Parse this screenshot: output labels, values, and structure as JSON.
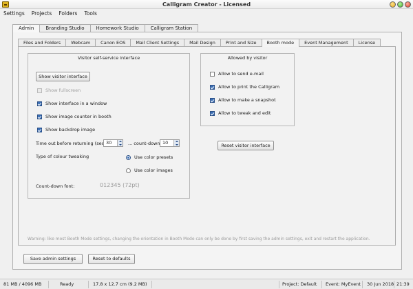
{
  "window": {
    "title": "Calligram Creator - Licensed"
  },
  "menu": [
    "Settings",
    "Projects",
    "Folders",
    "Tools"
  ],
  "top_tabs": [
    "Admin",
    "Branding Studio",
    "Homework Studio",
    "Calligram Station"
  ],
  "sub_tabs": [
    "Files and Folders",
    "Webcam",
    "Canon EOS",
    "Mail Client Settings",
    "Mail Design",
    "Print and Size",
    "Booth mode",
    "Event Management",
    "License"
  ],
  "visitor_interface": {
    "title": "Visitor self-service interface",
    "show_button": "Show visitor interface",
    "show_fullscreen": "Show fullscreen",
    "show_in_window": "Show interface in a window",
    "show_image_counter": "Show image counter in booth",
    "show_backdrop": "Show backdrop image",
    "timeout_label": "Time out before returning (sec)",
    "timeout_value": "30",
    "countdown_label": "... count-down",
    "countdown_value": "10",
    "colour_tweaking_label": "Type of colour tweaking",
    "use_presets": "Use color presets",
    "use_images": "Use color images",
    "font_label": "Count-down font:",
    "font_sample": "012345 (72pt)"
  },
  "allowed": {
    "title": "Allowed by visitor",
    "send_email": "Allow to send e-mail",
    "print": "Allow to print the Calligram",
    "snapshot": "Allow to make a snapshot",
    "tweak": "Allow to tweak and edit"
  },
  "reset_visitor_button": "Reset visitor interface",
  "warning": "Warning: like most Booth Mode settings, changing the orientation in Booth Mode can only be done by first saving the admin settings, exit and restart the application.",
  "save_button": "Save admin settings",
  "reset_defaults_button": "Reset to defaults",
  "status": {
    "memory": "81 MB / 4096 MB",
    "state": "Ready",
    "size": "17.8 x 12.7 cm  (9.2 MB)",
    "project": "Project: Default",
    "event": "Event: MyEvent",
    "date": "30 Jun 2018",
    "time": "21:39"
  }
}
